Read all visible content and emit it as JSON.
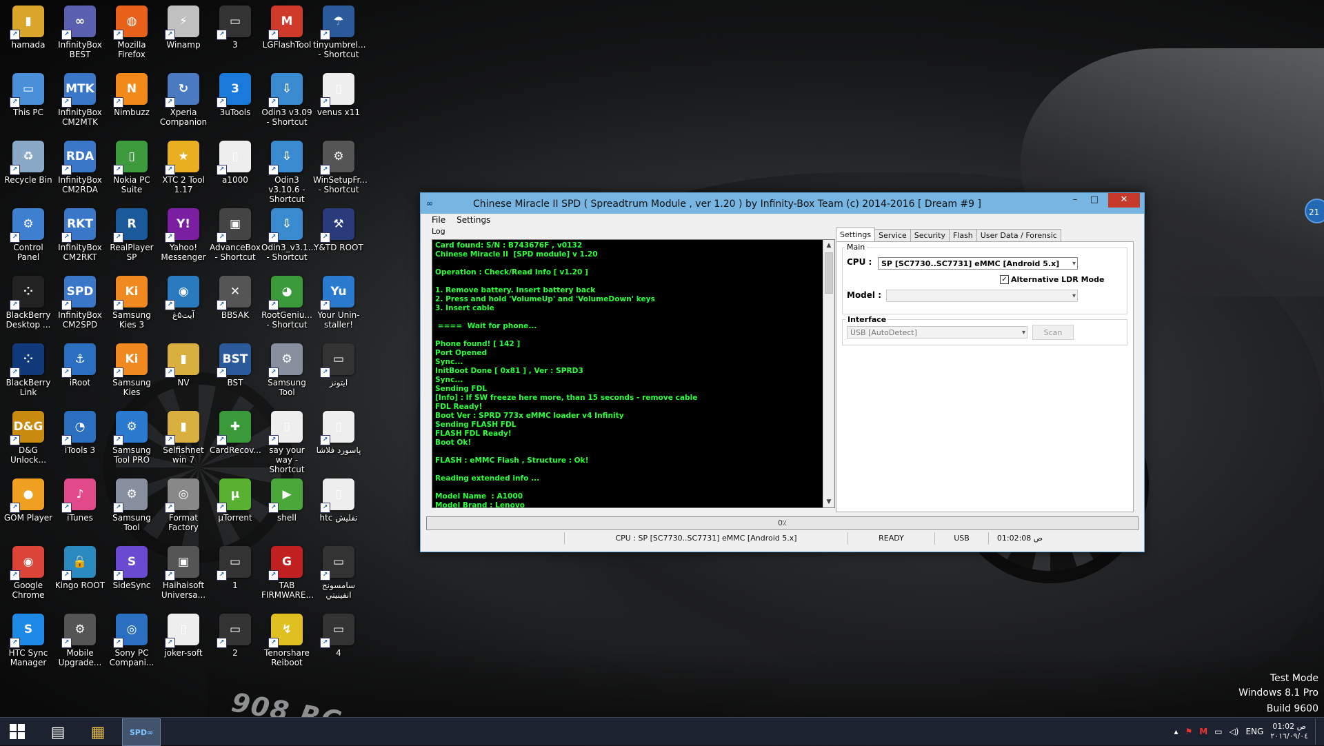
{
  "desktop_icons": [
    {
      "label": "hamada",
      "glyph": "▮",
      "color": "#d9a52b"
    },
    {
      "label": "This PC",
      "glyph": "▭",
      "color": "#4a90d9"
    },
    {
      "label": "Recycle Bin",
      "glyph": "♻",
      "color": "#8aa9c9"
    },
    {
      "label": "Control Panel",
      "glyph": "⚙",
      "color": "#3e7fcf"
    },
    {
      "label": "BlackBerry Desktop ...",
      "glyph": "⁘",
      "color": "#222"
    },
    {
      "label": "BlackBerry Link",
      "glyph": "⁘",
      "color": "#123a7a"
    },
    {
      "label": "D&G Unlock...",
      "glyph": "D&G",
      "color": "#c98a10"
    },
    {
      "label": "GOM Player",
      "glyph": "●",
      "color": "#f0a020"
    },
    {
      "label": "Google Chrome",
      "glyph": "◉",
      "color": "#db4437"
    },
    {
      "label": "HTC Sync Manager",
      "glyph": "S",
      "color": "#1e88e5"
    },
    {
      "label": "InfinityBox BEST",
      "glyph": "∞",
      "color": "#5a5fb0"
    },
    {
      "label": "InfinityBox CM2MTK",
      "glyph": "MTK",
      "color": "#3a77c8"
    },
    {
      "label": "InfinityBox CM2RDA",
      "glyph": "RDA",
      "color": "#3a77c8"
    },
    {
      "label": "InfinityBox CM2RKT",
      "glyph": "RKT",
      "color": "#3a77c8"
    },
    {
      "label": "InfinityBox CM2SPD",
      "glyph": "SPD",
      "color": "#3a77c8"
    },
    {
      "label": "iRoot",
      "glyph": "⚓",
      "color": "#2a6fc0"
    },
    {
      "label": "iTools 3",
      "glyph": "◔",
      "color": "#2a6fc0"
    },
    {
      "label": "iTunes",
      "glyph": "♪",
      "color": "#e04a8a"
    },
    {
      "label": "Kingo ROOT",
      "glyph": "🔒",
      "color": "#2a8ac0"
    },
    {
      "label": "Mobile Upgrade...",
      "glyph": "⚙",
      "color": "#555"
    },
    {
      "label": "Mozilla Firefox",
      "glyph": "◍",
      "color": "#e8621c"
    },
    {
      "label": "Nimbuzz",
      "glyph": "N",
      "color": "#f28a1a"
    },
    {
      "label": "Nokia PC Suite",
      "glyph": "▯",
      "color": "#3d9a3d"
    },
    {
      "label": "RealPlayer SP",
      "glyph": "R",
      "color": "#1a5a9a"
    },
    {
      "label": "Samsung Kies 3",
      "glyph": "Ki",
      "color": "#f08a20"
    },
    {
      "label": "Samsung Kies",
      "glyph": "Ki",
      "color": "#f08a20"
    },
    {
      "label": "Samsung Tool PRO",
      "glyph": "⚙",
      "color": "#2a7ad0"
    },
    {
      "label": "Samsung Tool",
      "glyph": "⚙",
      "color": "#8890a0"
    },
    {
      "label": "SideSync",
      "glyph": "S",
      "color": "#6a4ad0"
    },
    {
      "label": "Sony PC Compani...",
      "glyph": "◎",
      "color": "#2a6fc0"
    },
    {
      "label": "Winamp",
      "glyph": "⚡",
      "color": "#c0c0c0"
    },
    {
      "label": "Xperia Companion",
      "glyph": "↻",
      "color": "#4a7ac0"
    },
    {
      "label": "XTC 2 Tool 1.17",
      "glyph": "★",
      "color": "#e8b020"
    },
    {
      "label": "Yahoo! Messenger",
      "glyph": "Y!",
      "color": "#7b1fa2"
    },
    {
      "label": "آیت۵غ",
      "glyph": "◉",
      "color": "#2a7ac0"
    },
    {
      "label": "NV",
      "glyph": "▮",
      "color": "#d9b040"
    },
    {
      "label": "Selfishnet win 7",
      "glyph": "▮",
      "color": "#d9b040"
    },
    {
      "label": "Format Factory",
      "glyph": "◎",
      "color": "#888"
    },
    {
      "label": "Haihaisoft Universa...",
      "glyph": "▣",
      "color": "#555"
    },
    {
      "label": "joker-soft",
      "glyph": "▯",
      "color": "#eee"
    },
    {
      "label": "3",
      "glyph": "▭",
      "color": "#333"
    },
    {
      "label": "3uTools",
      "glyph": "3",
      "color": "#1a7ad9"
    },
    {
      "label": "a1000",
      "glyph": "▯",
      "color": "#eee"
    },
    {
      "label": "AdvanceBox - Shortcut",
      "glyph": "▣",
      "color": "#444"
    },
    {
      "label": "BBSAK",
      "glyph": "✕",
      "color": "#555"
    },
    {
      "label": "BST",
      "glyph": "BST",
      "color": "#2a5a9a"
    },
    {
      "label": "CardRecov...",
      "glyph": "✚",
      "color": "#3a9a3a"
    },
    {
      "label": "µTorrent",
      "glyph": "µ",
      "color": "#5ab030"
    },
    {
      "label": "1",
      "glyph": "▭",
      "color": "#333"
    },
    {
      "label": "2",
      "glyph": "▭",
      "color": "#333"
    },
    {
      "label": "LGFlashTool",
      "glyph": "M",
      "color": "#d03a2a"
    },
    {
      "label": "Odin3 v3.09 - Shortcut",
      "glyph": "⇩",
      "color": "#3a8ad0"
    },
    {
      "label": "Odin3 v3.10.6 - Shortcut",
      "glyph": "⇩",
      "color": "#3a8ad0"
    },
    {
      "label": "Odin3_v3.1... - Shortcut",
      "glyph": "⇩",
      "color": "#3a8ad0"
    },
    {
      "label": "RootGeniu... - Shortcut",
      "glyph": "◕",
      "color": "#3a9a3a"
    },
    {
      "label": "Samsung Tool",
      "glyph": "⚙",
      "color": "#8890a0"
    },
    {
      "label": "say your way - Shortcut",
      "glyph": "▯",
      "color": "#eee"
    },
    {
      "label": "shell",
      "glyph": "▶",
      "color": "#4aa83a"
    },
    {
      "label": "TAB FIRMWARE...",
      "glyph": "G",
      "color": "#c02020"
    },
    {
      "label": "Tenorshare Reiboot",
      "glyph": "↯",
      "color": "#e0c020"
    },
    {
      "label": "tinyumbrel... - Shortcut",
      "glyph": "☂",
      "color": "#2a5a9a"
    },
    {
      "label": "venus x11",
      "glyph": "▯",
      "color": "#eee"
    },
    {
      "label": "WinSetupFr... - Shortcut",
      "glyph": "⚙",
      "color": "#555"
    },
    {
      "label": "Y&TD ROOT",
      "glyph": "⚒",
      "color": "#2a3a7a"
    },
    {
      "label": "Your Unin-staller!",
      "glyph": "Yu",
      "color": "#2a7ad0"
    },
    {
      "label": "ایتونز",
      "glyph": "▭",
      "color": "#333"
    },
    {
      "label": "پاسورد فلاشا",
      "glyph": "▯",
      "color": "#eee"
    },
    {
      "label": "htc تفليش",
      "glyph": "▯",
      "color": "#eee"
    },
    {
      "label": "سامسونج انفينيتي",
      "glyph": "▭",
      "color": "#333"
    },
    {
      "label": "4",
      "glyph": "▭",
      "color": "#333"
    }
  ],
  "wallpaper": {
    "plate": "908 RC"
  },
  "window": {
    "title": "Chinese Miracle II SPD ( Spreadtrum Module , ver 1.20 ) by Infinity-Box Team (c) 2014-2016 [ Dream #9 ]",
    "app_icon": "spd-infinity-icon",
    "controls": {
      "minimize": "–",
      "maximize": "□",
      "close": "✕"
    },
    "menu": [
      "File",
      "Settings"
    ],
    "log_label": "Log",
    "log_lines": [
      "Card found: S/N : B743676F , v0132",
      "Chinese Miracle II  [SPD module] v 1.20",
      "",
      "Operation : Check/Read Info [ v1.20 ]",
      "",
      "1. Remove battery. Insert battery back",
      "2. Press and hold 'VolumeUp' and 'VolumeDown' keys",
      "3. Insert cable",
      "",
      " ====  Wait for phone...",
      "",
      "Phone found! [ 142 ]",
      "Port Opened",
      "Sync...",
      "InitBoot Done [ 0x81 ] , Ver : SPRD3",
      "Sync...",
      "Sending FDL",
      "[Info] : If SW freeze here more, than 15 seconds - remove cable",
      "FDL Ready!",
      "Boot Ver : SPRD 773x eMMC loader v4 Infinity",
      "Sending FLASH FDL",
      "FLASH FDL Ready!",
      "Boot Ok!",
      "",
      "FLASH : eMMC Flash , Structure : Ok!",
      "",
      "Reading extended info ...",
      "",
      "Model Name  : A1000",
      "Model Brand : Lenovo"
    ],
    "progress_text": "0٪",
    "progress_value": 0,
    "status": {
      "cpu": "CPU : SP [SC7730..SC7731] eMMC [Android 5.x]",
      "state": "READY",
      "conn": "USB",
      "time": "01:02:08 ص"
    },
    "tabs": [
      "Settings",
      "Service",
      "Security",
      "Flash",
      "User Data / Forensic"
    ],
    "active_tab": 0,
    "settings": {
      "main_group": "Main",
      "cpu_label": "CPU :",
      "cpu_value": "SP [SC7730..SC7731] eMMC [Android 5.x]",
      "alt_ldr": "Alternative LDR Mode",
      "alt_ldr_checked": true,
      "model_label": "Model :",
      "model_value": "",
      "interface_group": "Interface",
      "interface_value": "USB [AutoDetect]",
      "scan_label": "Scan"
    }
  },
  "watermark": {
    "line1": "Test Mode",
    "line2": "Windows 8.1 Pro",
    "line3": "Build 9600"
  },
  "edge_badge": "21",
  "taskbar": {
    "apps": [
      {
        "name": "taskbar-network-app",
        "glyph": "▤"
      },
      {
        "name": "taskbar-explorer",
        "glyph": "▦"
      },
      {
        "name": "taskbar-spd-app",
        "glyph": "SPD∞",
        "active": true
      }
    ],
    "tray": {
      "lang": "ENG",
      "time": "01:02 ص",
      "date": "٢٠١٦/٠٩/٠٤"
    }
  },
  "colors": {
    "log_text": "#2bff3a",
    "titlebar": "#77b6e3",
    "close": "#c7392b"
  }
}
